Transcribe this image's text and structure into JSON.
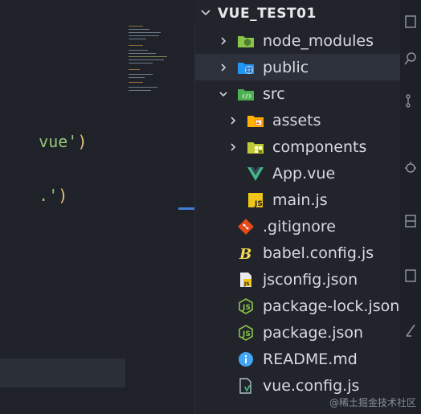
{
  "editor": {
    "code_fragments": [
      {
        "text_str": "vue'",
        "text_paren": ")"
      },
      {
        "text_str": ".'",
        "text_paren": ")"
      }
    ]
  },
  "explorer": {
    "project_title": "VUE_TEST01",
    "items": [
      {
        "label": "node_modules",
        "type": "folder",
        "expanded": false,
        "icon": "node-modules-folder-icon"
      },
      {
        "label": "public",
        "type": "folder",
        "expanded": false,
        "icon": "public-folder-icon",
        "selected": true
      },
      {
        "label": "src",
        "type": "folder",
        "expanded": true,
        "icon": "src-folder-icon"
      },
      {
        "label": "assets",
        "type": "folder",
        "expanded": false,
        "icon": "assets-folder-icon"
      },
      {
        "label": "components",
        "type": "folder",
        "expanded": false,
        "icon": "components-folder-icon"
      },
      {
        "label": "App.vue",
        "type": "file",
        "icon": "vue-file-icon"
      },
      {
        "label": "main.js",
        "type": "file",
        "icon": "js-file-icon"
      },
      {
        "label": ".gitignore",
        "type": "file",
        "icon": "git-file-icon"
      },
      {
        "label": "babel.config.js",
        "type": "file",
        "icon": "babel-file-icon"
      },
      {
        "label": "jsconfig.json",
        "type": "file",
        "icon": "jsconfig-file-icon"
      },
      {
        "label": "package-lock.json",
        "type": "file",
        "icon": "node-json-icon"
      },
      {
        "label": "package.json",
        "type": "file",
        "icon": "node-json-icon"
      },
      {
        "label": "README.md",
        "type": "file",
        "icon": "info-file-icon"
      },
      {
        "label": "vue.config.js",
        "type": "file",
        "icon": "vue-config-file-icon"
      }
    ]
  },
  "watermark": "@稀土掘金技术社区",
  "colors": {
    "selected_row": "#2c313c",
    "accent": "#3e7dd8"
  }
}
